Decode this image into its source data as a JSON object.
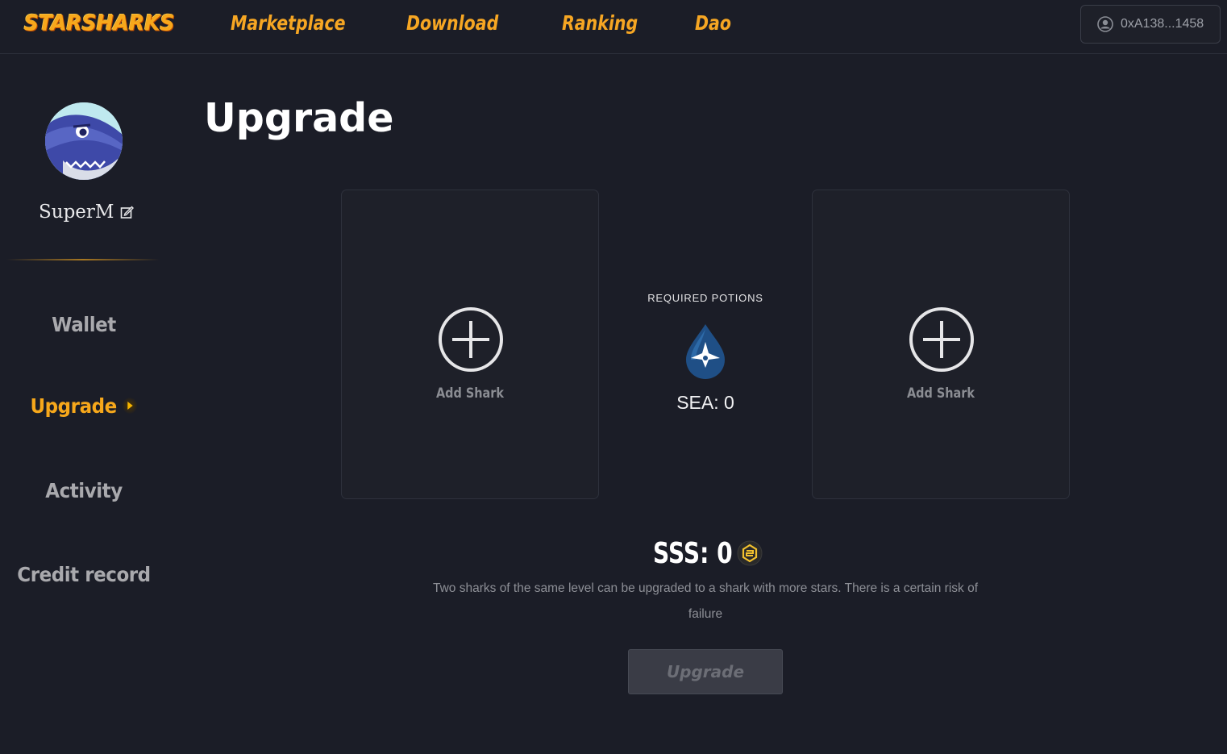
{
  "header": {
    "logo": "STARSHARKS",
    "nav": [
      {
        "label": "Marketplace"
      },
      {
        "label": "Download"
      },
      {
        "label": "Ranking"
      },
      {
        "label": "Dao"
      }
    ],
    "wallet_address": "0xA138...1458",
    "wallet_icon": "user-circle-icon"
  },
  "sidebar": {
    "username": "SuperM",
    "edit_icon": "edit-icon",
    "items": [
      {
        "label": "Wallet",
        "active": false
      },
      {
        "label": "Upgrade",
        "active": true
      },
      {
        "label": "Activity",
        "active": false
      },
      {
        "label": "Credit record",
        "active": false
      }
    ]
  },
  "main": {
    "title": "Upgrade",
    "left_card": {
      "label": "Add Shark",
      "icon": "plus-circle-icon"
    },
    "right_card": {
      "label": "Add Shark",
      "icon": "plus-circle-icon"
    },
    "potions": {
      "title": "REQUIRED POTIONS",
      "icon": "sea-drop-icon",
      "value": "SEA: 0"
    },
    "sss": {
      "value": "SSS: 0",
      "icon": "sss-coin-icon"
    },
    "description": "Two sharks of the same level can be upgraded to a shark with more stars. There is a certain risk of failure",
    "button": "Upgrade"
  },
  "colors": {
    "background": "#1b1d27",
    "accent": "#f7a81b",
    "card": "#1e2029",
    "button_disabled": "#3a3c46"
  }
}
